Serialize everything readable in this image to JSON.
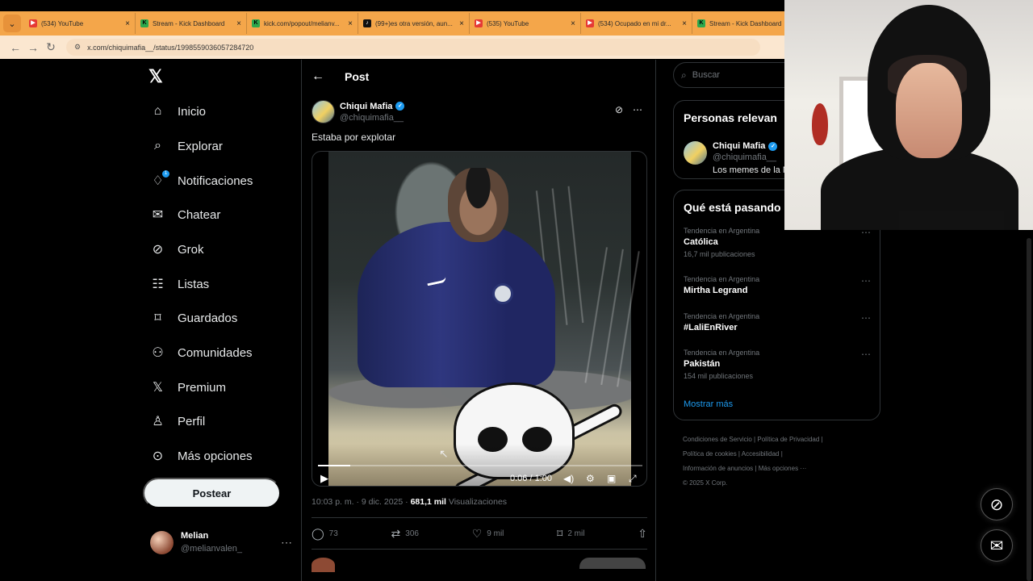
{
  "browser": {
    "menu_icon": "chevron-down-icon",
    "tabs": [
      {
        "title": "(534) YouTube",
        "icon": "youtube-icon"
      },
      {
        "title": "Stream - Kick Dashboard",
        "icon": "kick-icon"
      },
      {
        "title": "kick.com/popout/melianv...",
        "icon": "kick-icon"
      },
      {
        "title": "(99+)es otra versión, aun...",
        "icon": "tiktok-icon"
      },
      {
        "title": "(535) YouTube",
        "icon": "youtube-icon"
      },
      {
        "title": "(534) Ocupado en mi dr...",
        "icon": "youtube-icon"
      },
      {
        "title": "Stream - Kick Dashboard",
        "icon": "kick-icon"
      }
    ],
    "url": "x.com/chiquimafia__/status/1998559036057284720"
  },
  "x_nav": {
    "items": [
      {
        "label": "Inicio",
        "icon": "home-icon"
      },
      {
        "label": "Explorar",
        "icon": "search-icon"
      },
      {
        "label": "Notificaciones",
        "icon": "bell-icon",
        "badge": "1"
      },
      {
        "label": "Chatear",
        "icon": "mail-icon"
      },
      {
        "label": "Grok",
        "icon": "grok-icon"
      },
      {
        "label": "Listas",
        "icon": "list-icon"
      },
      {
        "label": "Guardados",
        "icon": "bookmark-icon"
      },
      {
        "label": "Comunidades",
        "icon": "communities-icon"
      },
      {
        "label": "Premium",
        "icon": "x-icon"
      },
      {
        "label": "Perfil",
        "icon": "profile-icon"
      },
      {
        "label": "Más opciones",
        "icon": "more-icon"
      }
    ],
    "post_button": "Postear",
    "account": {
      "name": "Melian",
      "handle": "@melianvalen_"
    }
  },
  "post": {
    "header_title": "Post",
    "author": {
      "name": "Chiqui Mafia",
      "handle": "@chiquimafia__"
    },
    "text": "Estaba por explotar",
    "video": {
      "time": "0:06 / 1:00",
      "progress": 0.1
    },
    "timestamp": "10:03 p. m. · 9 dic. 2025 ·",
    "views": "681,1 mil",
    "views_label": "Visualizaciones",
    "stats": [
      {
        "value": "73",
        "icon": "reply-icon"
      },
      {
        "value": "306",
        "icon": "repost-icon"
      },
      {
        "value": "9 mil",
        "icon": "like-icon"
      },
      {
        "value": "2 mil",
        "icon": "bookmark-icon"
      },
      {
        "value": "",
        "icon": "share-icon"
      }
    ]
  },
  "right_panel": {
    "search_placeholder": "Buscar",
    "relevant_title": "Personas relevan",
    "relevant_person": {
      "name": "Chiqui Mafia",
      "handle": "@chiquimafia__",
      "bio": "Los memes de la M"
    },
    "trending_title": "Qué está pasando",
    "trends": [
      {
        "category": "Tendencia en Argentina",
        "name": "Católica",
        "count": "16,7 mil publicaciones"
      },
      {
        "category": "Tendencia en Argentina",
        "name": "Mirtha Legrand",
        "count": ""
      },
      {
        "category": "Tendencia en Argentina",
        "name": "#LaliEnRiver",
        "count": ""
      },
      {
        "category": "Tendencia en Argentina",
        "name": "Pakistán",
        "count": "154 mil publicaciones"
      }
    ],
    "show_more": "Mostrar más",
    "footer": [
      "Condiciones de Servicio",
      "Política de Privacidad",
      "Política de cookies",
      "Accesibilidad",
      "Información de anuncios",
      "Más opciones ···",
      "© 2025 X Corp."
    ]
  },
  "floating": {
    "grok": "grok-icon",
    "messages": "mail-icon"
  },
  "colors": {
    "accent": "#1d9bf0",
    "browser": "#f4a64a",
    "background": "#000000"
  }
}
